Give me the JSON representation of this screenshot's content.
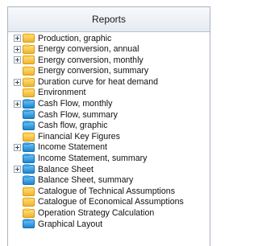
{
  "panel": {
    "title": "Reports"
  },
  "tree": [
    {
      "label": "Production, graphic",
      "expander": true,
      "color": "yellow"
    },
    {
      "label": "Energy conversion, annual",
      "expander": true,
      "color": "yellow"
    },
    {
      "label": "Energy conversion, monthly",
      "expander": true,
      "color": "yellow"
    },
    {
      "label": "Energy conversion, summary",
      "expander": false,
      "color": "yellow"
    },
    {
      "label": "Duration curve for heat demand",
      "expander": true,
      "color": "yellow"
    },
    {
      "label": "Environment",
      "expander": false,
      "color": "yellow"
    },
    {
      "label": "Cash Flow, monthly",
      "expander": true,
      "color": "blue"
    },
    {
      "label": "Cash Flow, summary",
      "expander": false,
      "color": "blue"
    },
    {
      "label": "Cash flow, graphic",
      "expander": false,
      "color": "blue"
    },
    {
      "label": "Financial Key Figures",
      "expander": false,
      "color": "yellow"
    },
    {
      "label": "Income Statement",
      "expander": true,
      "color": "blue"
    },
    {
      "label": "Income Statement, summary",
      "expander": false,
      "color": "blue"
    },
    {
      "label": "Balance Sheet",
      "expander": true,
      "color": "blue"
    },
    {
      "label": "Balance Sheet, summary",
      "expander": false,
      "color": "blue"
    },
    {
      "label": "Catalogue of Technical Assumptions",
      "expander": false,
      "color": "yellow"
    },
    {
      "label": "Catalogue of Economical Assumptions",
      "expander": false,
      "color": "yellow"
    },
    {
      "label": "Operation Strategy Calculation",
      "expander": false,
      "color": "yellow"
    },
    {
      "label": "Graphical Layout",
      "expander": false,
      "color": "blue"
    }
  ]
}
